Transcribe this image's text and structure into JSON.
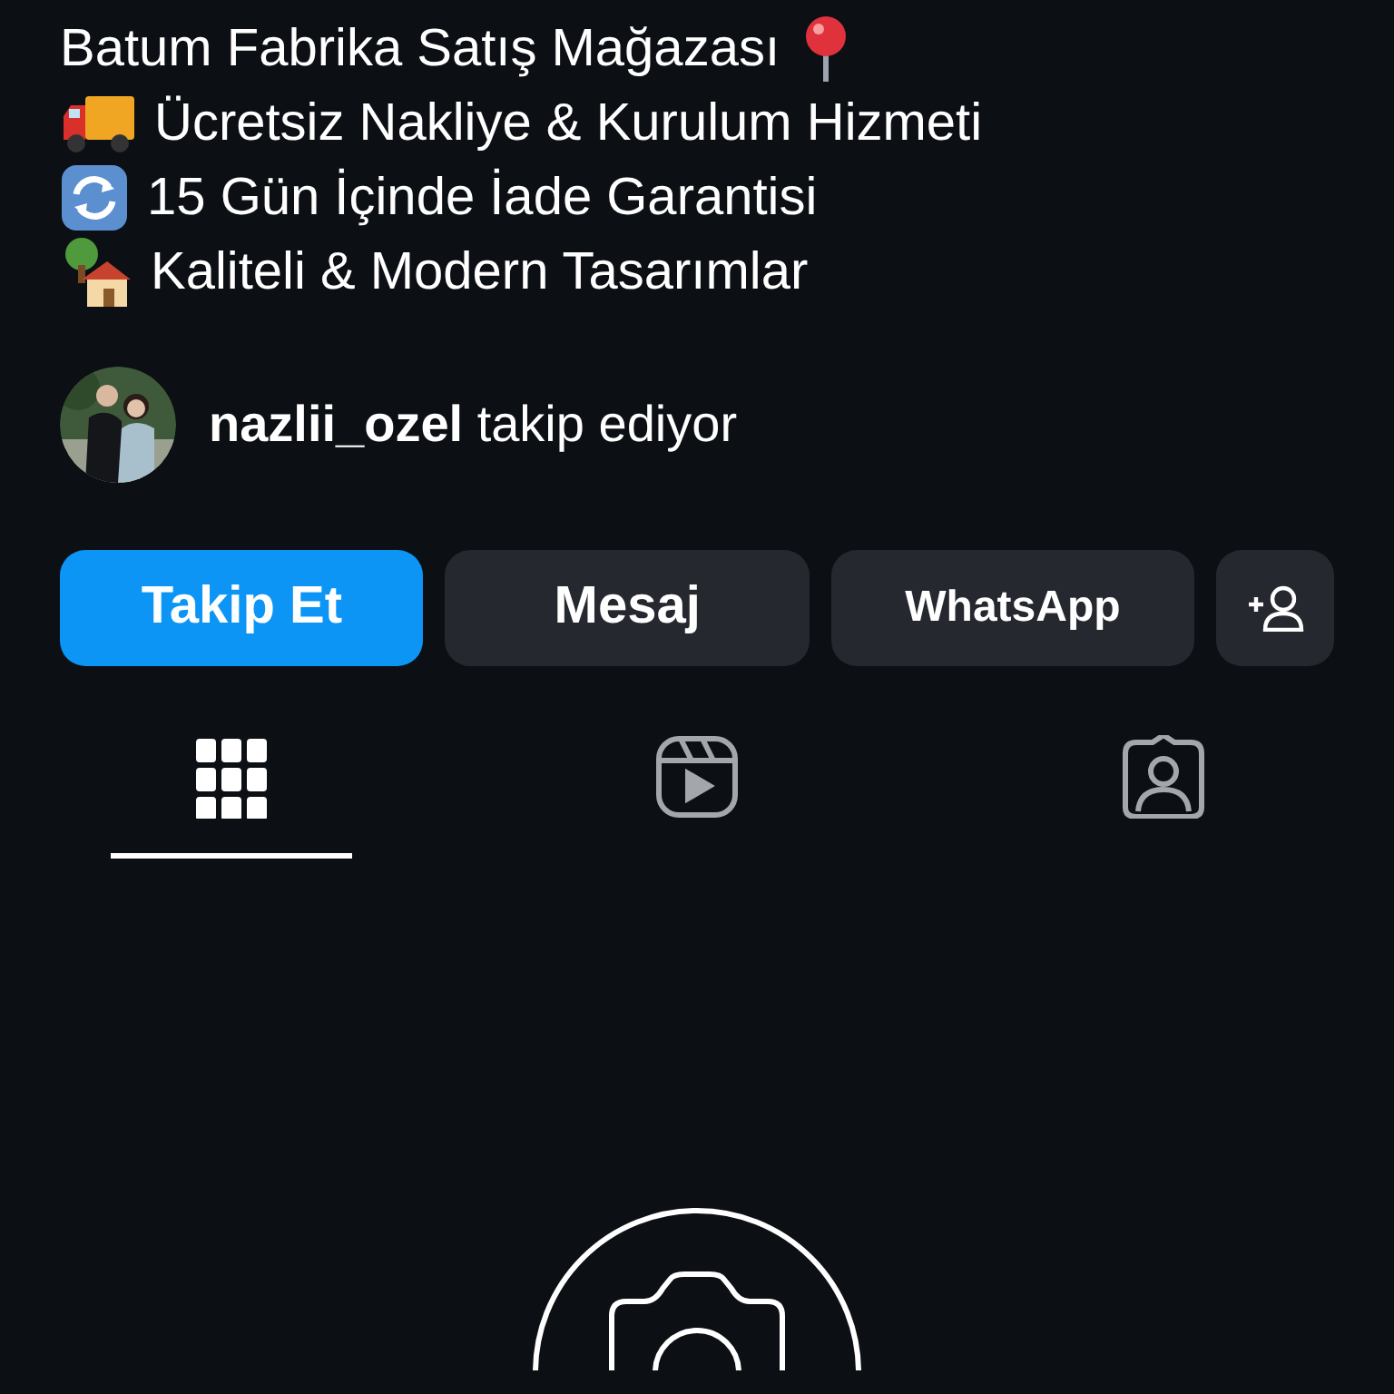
{
  "bio": [
    {
      "text": "Batum Fabrika Satış Mağazası",
      "kind": "pin"
    },
    {
      "text": "Ücretsiz Nakliye & Kurulum Hizmeti",
      "kind": "truck"
    },
    {
      "text": "15 Gün İçinde İade Garantisi",
      "kind": "arrows"
    },
    {
      "text": "Kaliteli & Modern Tasarımlar",
      "kind": "house"
    }
  ],
  "followed_by": {
    "text": "**nazlii_ozel** takip ediyor"
  },
  "buttons": [
    {
      "label": "Takip Et",
      "kind": "primary"
    },
    {
      "label": "Mesaj",
      "kind": "secondary"
    },
    {
      "label": "WhatsApp",
      "kind": "secondary"
    },
    {
      "kind": "add-person"
    }
  ],
  "tabs": [
    {
      "kind": "grid",
      "selected": true
    },
    {
      "kind": "reels",
      "selected": false
    },
    {
      "kind": "tagged",
      "selected": false
    }
  ],
  "empty_state": {
    "kind": "camera"
  }
}
